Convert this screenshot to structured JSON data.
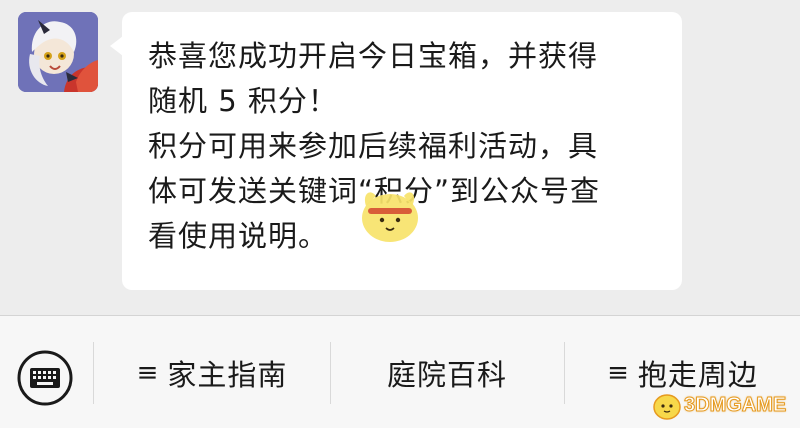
{
  "chat": {
    "message_lines": [
      "恭喜您成功开启今日宝箱，并获得",
      "随机 5 积分！",
      "积分可用来参加后续福利活动，具",
      "体可发送关键词“积分”到公众号查",
      "看使用说明。"
    ]
  },
  "menu": {
    "keyboard_icon": "keyboard-icon",
    "items": [
      {
        "label": "家主指南",
        "has_submenu": true
      },
      {
        "label": "庭院百科",
        "has_submenu": false
      },
      {
        "label": "抱走周边",
        "has_submenu": true
      }
    ],
    "submenu_icon": "≡"
  },
  "watermark": {
    "text": "3DMGAME"
  },
  "colors": {
    "background": "#ededed",
    "bubble": "#ffffff",
    "menu_bar": "#f7f7f7",
    "watermark": "#e69a1f"
  }
}
